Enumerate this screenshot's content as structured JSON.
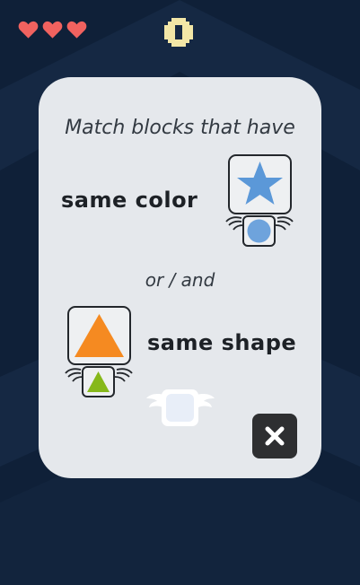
{
  "hud": {
    "lives": 3,
    "heart_icons": [
      "heart-icon",
      "heart-icon",
      "heart-icon"
    ],
    "score_icon": "pixel-zero-icon"
  },
  "tutorial": {
    "intro_text": "Match blocks that have",
    "rule_color": "same color",
    "connector": "or  /  and",
    "rule_shape": "same shape"
  },
  "colors": {
    "background": "#0f2038",
    "panel": "#e5e8ec",
    "heart": "#f0625f",
    "score": "#f2e6a6",
    "star": "#5b98d8",
    "circle": "#6ea3dc",
    "triangle_big": "#f58a21",
    "triangle_small": "#86b81a"
  },
  "icons": {
    "close": "close-x-icon"
  }
}
